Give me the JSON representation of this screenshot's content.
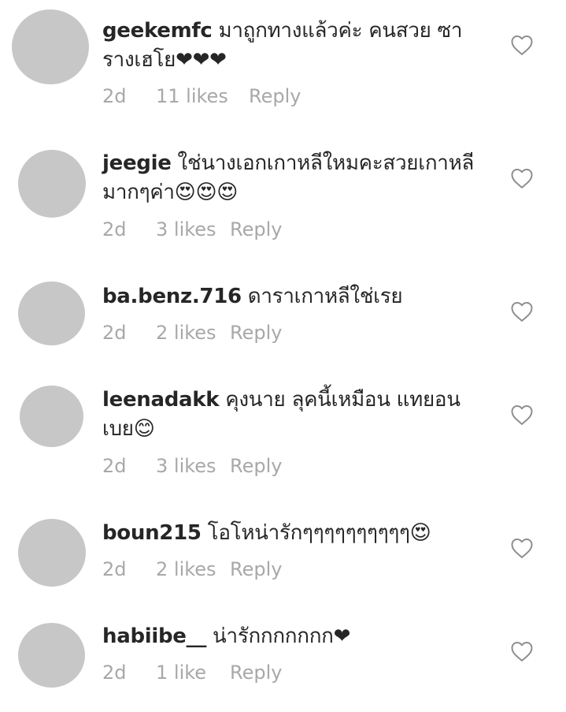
{
  "comments": [
    {
      "username": "geekemfc",
      "text": "มาถูกทางแล้วค่ะ คนสวย ซารางเฮโย❤❤❤",
      "time": "2d",
      "likes": "11 likes",
      "reply": "Reply"
    },
    {
      "username": "jeegie",
      "text": "ใช่นางเอกเกาหลีใหมคะสวยเกาหลีมากๆค่า😍😍😍",
      "time": "2d",
      "likes": "3 likes",
      "reply": "Reply"
    },
    {
      "username": "ba.benz.716",
      "text": "ดาราเกาหลีใช่เรย",
      "time": "2d",
      "likes": "2 likes",
      "reply": "Reply"
    },
    {
      "username": "leenadakk",
      "text": "คุงนาย ลุคนี้เหมือน แทยอนเบย😊",
      "time": "2d",
      "likes": "3 likes",
      "reply": "Reply"
    },
    {
      "username": "boun215",
      "text": "โอโหน่ารักๆๆๆๆๆๆๆๆๆๆ😍",
      "time": "2d",
      "likes": "2 likes",
      "reply": "Reply"
    },
    {
      "username": "habiibe__",
      "text": "น่ารักกกกกกก❤",
      "time": "2d",
      "likes": "1 like",
      "reply": "Reply"
    }
  ],
  "icons": {
    "like": "heart-outline-icon"
  },
  "colors": {
    "avatar": "#c7c7c7",
    "meta_text": "#a8a8a8",
    "primary_text": "#262626",
    "heart_stroke": "#8e8e8e"
  }
}
